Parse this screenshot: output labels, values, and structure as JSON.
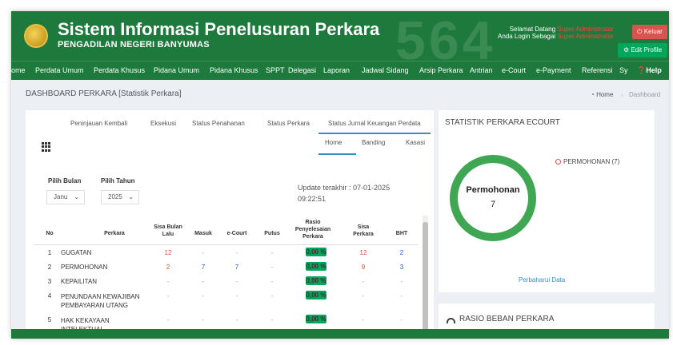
{
  "header": {
    "title": "Sistem Informasi Penelusuran Perkara",
    "subtitle": "PENGADILAN NEGERI BANYUMAS",
    "welcome_line1": "Selamat Datang",
    "welcome_line2": "Anda Login Sebagai",
    "role_line1": "Super Administrator",
    "role_line2": "Super Administrator",
    "logout_label": "Keluar",
    "edit_profile_label": "Edit Profile"
  },
  "nav": {
    "items": [
      "ome",
      "Perdata Umum",
      "Perdata Khusus",
      "Pidana Umum",
      "Pidana Khusus",
      "SPPT",
      "Delegasi",
      "Laporan",
      "Jadwal Sidang",
      "Arsip Perkara",
      "Antrian",
      "e-Court",
      "e-Payment",
      "Referensi",
      "Sy",
      "Help"
    ]
  },
  "breadcrumb": {
    "page_title": "DASHBOARD PERKARA  [Statistik Perkara]",
    "home": "Home",
    "current": "Dashboard"
  },
  "left_panel": {
    "tabs_top": [
      "Peninjauan Kembali",
      "Eksekusi",
      "Status Penahanan",
      "Status Perkara",
      "Status Jurnal Keuangan Perdata"
    ],
    "tabs_sub": [
      "Home",
      "Banding",
      "Kasasi"
    ],
    "filter_month_label": "Pilih Bulan",
    "filter_month_value": "Janu",
    "filter_year_label": "Pilih Tahun",
    "filter_year_value": "2025",
    "update_text": "Update terakhir : 07-01-2025 09:22:51",
    "table": {
      "headers": [
        "No",
        "Perkara",
        "Sisa Bulan Lalu",
        "Masuk",
        "e-Court",
        "Putus",
        "Rasio Penyelesaian Perkara",
        "Sisa Perkara",
        "BHT"
      ],
      "rows": [
        {
          "no": "1",
          "perkara": "GUGATAN",
          "sisa_lalu": "12",
          "masuk": "-",
          "ecourt": "-",
          "putus": "-",
          "rasio": "0,00 %",
          "sisa": "12",
          "bht": "2"
        },
        {
          "no": "2",
          "perkara": "PERMOHONAN",
          "sisa_lalu": "2",
          "masuk": "7",
          "ecourt": "7",
          "putus": "-",
          "rasio": "0,00 %",
          "sisa": "9",
          "bht": "3"
        },
        {
          "no": "3",
          "perkara": "KEPAILITAN",
          "sisa_lalu": "-",
          "masuk": "-",
          "ecourt": "-",
          "putus": "-",
          "rasio": "0,00 %",
          "sisa": "-",
          "bht": "-"
        },
        {
          "no": "4",
          "perkara": "PENUNDAAN KEWAJIBAN PEMBAYARAN UTANG",
          "sisa_lalu": "-",
          "masuk": "-",
          "ecourt": "-",
          "putus": "-",
          "rasio": "0,00 %",
          "sisa": "-",
          "bht": "-"
        },
        {
          "no": "5",
          "perkara": "HAK KEKAYAAN INTELEKTUAL",
          "sisa_lalu": "-",
          "masuk": "-",
          "ecourt": "-",
          "putus": "-",
          "rasio": "0,00 %",
          "sisa": "-",
          "bht": "-"
        }
      ]
    }
  },
  "ecourt_panel": {
    "title": "STATISTIK PERKARA ECOURT",
    "donut_label": "Permohonan",
    "donut_value": "7",
    "legend": "PERMOHONAN (7)",
    "refresh_label": "Perbaharui Data"
  },
  "rasio_panel": {
    "title": "RASIO BEBAN PERKARA"
  },
  "colors": {
    "brand_green": "#1e7a3c",
    "success": "#00a65a",
    "danger": "#d9534f",
    "link": "#3c8dbc"
  }
}
